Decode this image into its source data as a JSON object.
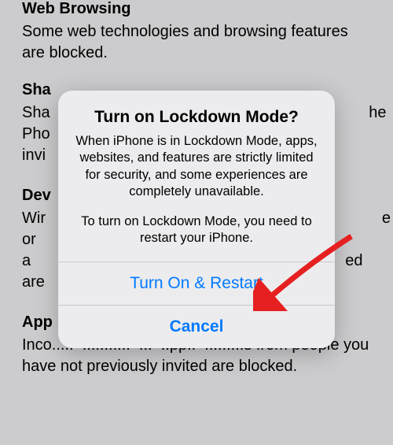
{
  "background": {
    "sections": [
      {
        "title": "Web Browsing",
        "body": "Some web technologies and browsing features are blocked."
      },
      {
        "title": "Sha",
        "body": "Sha                                                              he Pho invi"
      },
      {
        "title": "Dev",
        "body": "Wir                                                                e or a                                                            ed are"
      },
      {
        "title": "App",
        "body": "Inco.......  .............  ...  ..pp..  ........s from people you have not previously invited are blocked."
      }
    ]
  },
  "dialog": {
    "title": "Turn on Lockdown Mode?",
    "message1": "When iPhone is in Lockdown Mode, apps, websites, and features are strictly limited for security, and some experiences are completely unavailable.",
    "message2": "To turn on Lockdown Mode, you need to restart your iPhone.",
    "primary_label": "Turn On & Restart",
    "cancel_label": "Cancel"
  }
}
